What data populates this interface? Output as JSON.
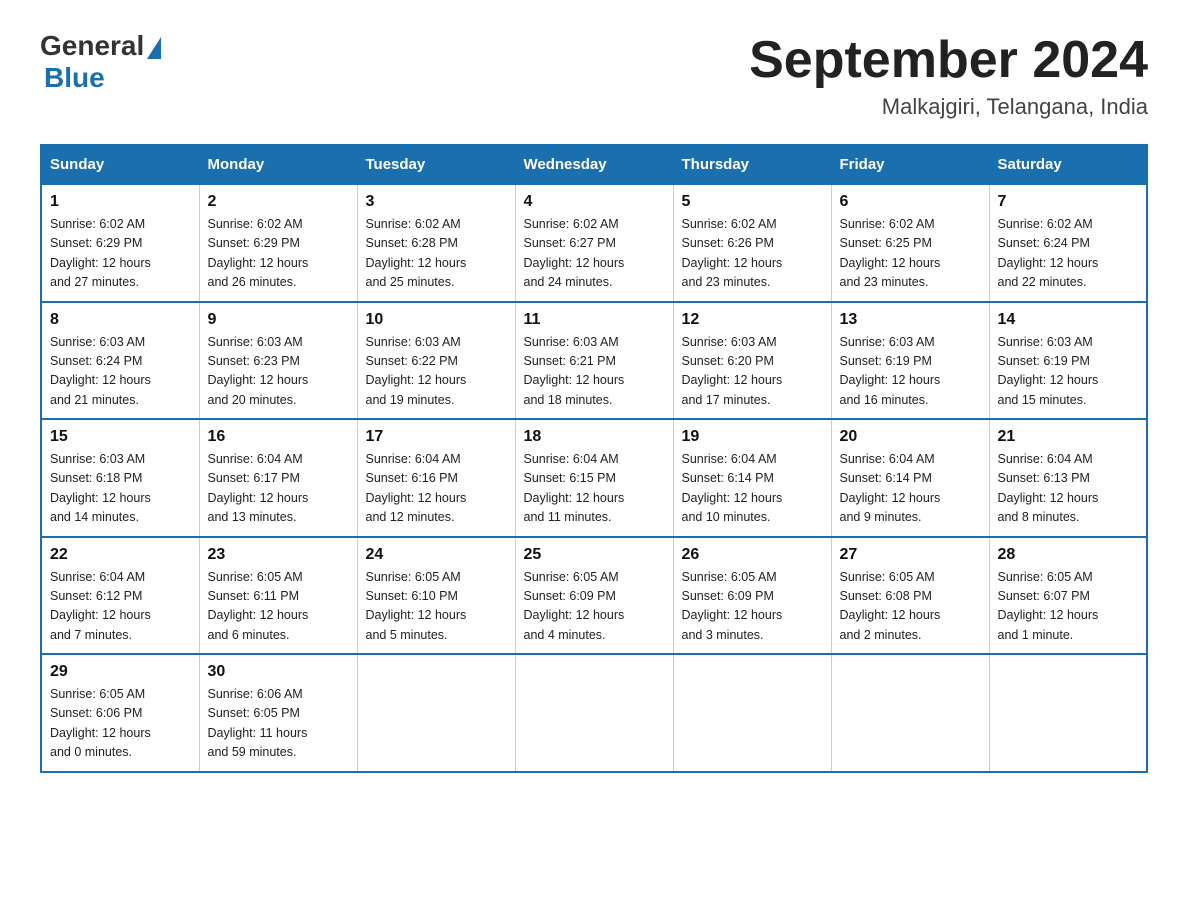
{
  "logo": {
    "general": "General",
    "blue": "Blue"
  },
  "title": {
    "month_year": "September 2024",
    "location": "Malkajgiri, Telangana, India"
  },
  "headers": [
    "Sunday",
    "Monday",
    "Tuesday",
    "Wednesday",
    "Thursday",
    "Friday",
    "Saturday"
  ],
  "weeks": [
    [
      {
        "day": "1",
        "sunrise": "6:02 AM",
        "sunset": "6:29 PM",
        "daylight": "12 hours and 27 minutes."
      },
      {
        "day": "2",
        "sunrise": "6:02 AM",
        "sunset": "6:29 PM",
        "daylight": "12 hours and 26 minutes."
      },
      {
        "day": "3",
        "sunrise": "6:02 AM",
        "sunset": "6:28 PM",
        "daylight": "12 hours and 25 minutes."
      },
      {
        "day": "4",
        "sunrise": "6:02 AM",
        "sunset": "6:27 PM",
        "daylight": "12 hours and 24 minutes."
      },
      {
        "day": "5",
        "sunrise": "6:02 AM",
        "sunset": "6:26 PM",
        "daylight": "12 hours and 23 minutes."
      },
      {
        "day": "6",
        "sunrise": "6:02 AM",
        "sunset": "6:25 PM",
        "daylight": "12 hours and 23 minutes."
      },
      {
        "day": "7",
        "sunrise": "6:02 AM",
        "sunset": "6:24 PM",
        "daylight": "12 hours and 22 minutes."
      }
    ],
    [
      {
        "day": "8",
        "sunrise": "6:03 AM",
        "sunset": "6:24 PM",
        "daylight": "12 hours and 21 minutes."
      },
      {
        "day": "9",
        "sunrise": "6:03 AM",
        "sunset": "6:23 PM",
        "daylight": "12 hours and 20 minutes."
      },
      {
        "day": "10",
        "sunrise": "6:03 AM",
        "sunset": "6:22 PM",
        "daylight": "12 hours and 19 minutes."
      },
      {
        "day": "11",
        "sunrise": "6:03 AM",
        "sunset": "6:21 PM",
        "daylight": "12 hours and 18 minutes."
      },
      {
        "day": "12",
        "sunrise": "6:03 AM",
        "sunset": "6:20 PM",
        "daylight": "12 hours and 17 minutes."
      },
      {
        "day": "13",
        "sunrise": "6:03 AM",
        "sunset": "6:19 PM",
        "daylight": "12 hours and 16 minutes."
      },
      {
        "day": "14",
        "sunrise": "6:03 AM",
        "sunset": "6:19 PM",
        "daylight": "12 hours and 15 minutes."
      }
    ],
    [
      {
        "day": "15",
        "sunrise": "6:03 AM",
        "sunset": "6:18 PM",
        "daylight": "12 hours and 14 minutes."
      },
      {
        "day": "16",
        "sunrise": "6:04 AM",
        "sunset": "6:17 PM",
        "daylight": "12 hours and 13 minutes."
      },
      {
        "day": "17",
        "sunrise": "6:04 AM",
        "sunset": "6:16 PM",
        "daylight": "12 hours and 12 minutes."
      },
      {
        "day": "18",
        "sunrise": "6:04 AM",
        "sunset": "6:15 PM",
        "daylight": "12 hours and 11 minutes."
      },
      {
        "day": "19",
        "sunrise": "6:04 AM",
        "sunset": "6:14 PM",
        "daylight": "12 hours and 10 minutes."
      },
      {
        "day": "20",
        "sunrise": "6:04 AM",
        "sunset": "6:14 PM",
        "daylight": "12 hours and 9 minutes."
      },
      {
        "day": "21",
        "sunrise": "6:04 AM",
        "sunset": "6:13 PM",
        "daylight": "12 hours and 8 minutes."
      }
    ],
    [
      {
        "day": "22",
        "sunrise": "6:04 AM",
        "sunset": "6:12 PM",
        "daylight": "12 hours and 7 minutes."
      },
      {
        "day": "23",
        "sunrise": "6:05 AM",
        "sunset": "6:11 PM",
        "daylight": "12 hours and 6 minutes."
      },
      {
        "day": "24",
        "sunrise": "6:05 AM",
        "sunset": "6:10 PM",
        "daylight": "12 hours and 5 minutes."
      },
      {
        "day": "25",
        "sunrise": "6:05 AM",
        "sunset": "6:09 PM",
        "daylight": "12 hours and 4 minutes."
      },
      {
        "day": "26",
        "sunrise": "6:05 AM",
        "sunset": "6:09 PM",
        "daylight": "12 hours and 3 minutes."
      },
      {
        "day": "27",
        "sunrise": "6:05 AM",
        "sunset": "6:08 PM",
        "daylight": "12 hours and 2 minutes."
      },
      {
        "day": "28",
        "sunrise": "6:05 AM",
        "sunset": "6:07 PM",
        "daylight": "12 hours and 1 minute."
      }
    ],
    [
      {
        "day": "29",
        "sunrise": "6:05 AM",
        "sunset": "6:06 PM",
        "daylight": "12 hours and 0 minutes."
      },
      {
        "day": "30",
        "sunrise": "6:06 AM",
        "sunset": "6:05 PM",
        "daylight": "11 hours and 59 minutes."
      },
      null,
      null,
      null,
      null,
      null
    ]
  ],
  "sunrise_label": "Sunrise:",
  "sunset_label": "Sunset:",
  "daylight_label": "Daylight:"
}
